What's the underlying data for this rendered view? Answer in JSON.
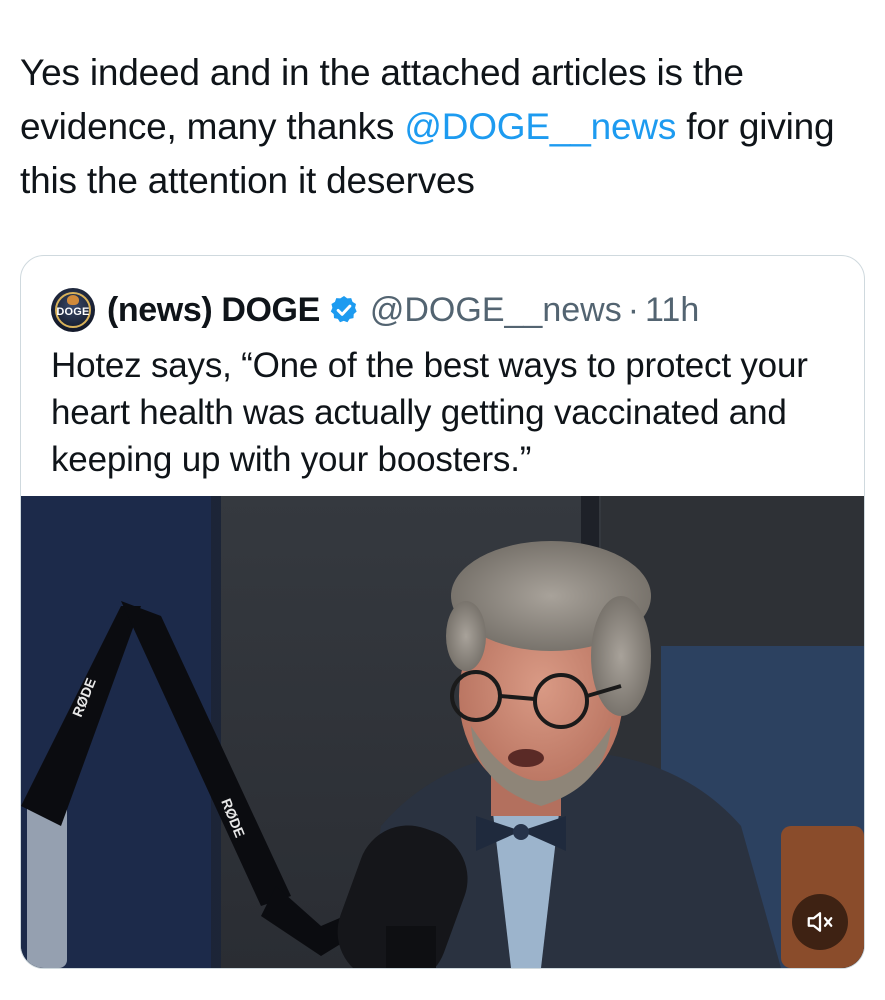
{
  "tweet": {
    "text_part1": "Yes indeed and in the attached articles is the evidence, many thanks ",
    "mention": "@DOGE__news",
    "text_part2": " for giving this the attention it deserves"
  },
  "quoted_tweet": {
    "avatar_text": "DOGE",
    "display_name": "(news) DOGE",
    "handle": "@DOGE__news",
    "separator": "·",
    "time": "11h",
    "text": "Hotez says, “One of the best ways to protect your heart health was actually getting vaccinated and keeping up with your boosters.”",
    "media": {
      "mic_arm_brand_top": "RØDE",
      "mic_arm_brand_bottom": "RØDE",
      "mute_icon": "speaker-muted-icon"
    }
  },
  "colors": {
    "text": "#0f1419",
    "secondary": "#536471",
    "link": "#1d9bf0",
    "border": "#cfd9de"
  }
}
